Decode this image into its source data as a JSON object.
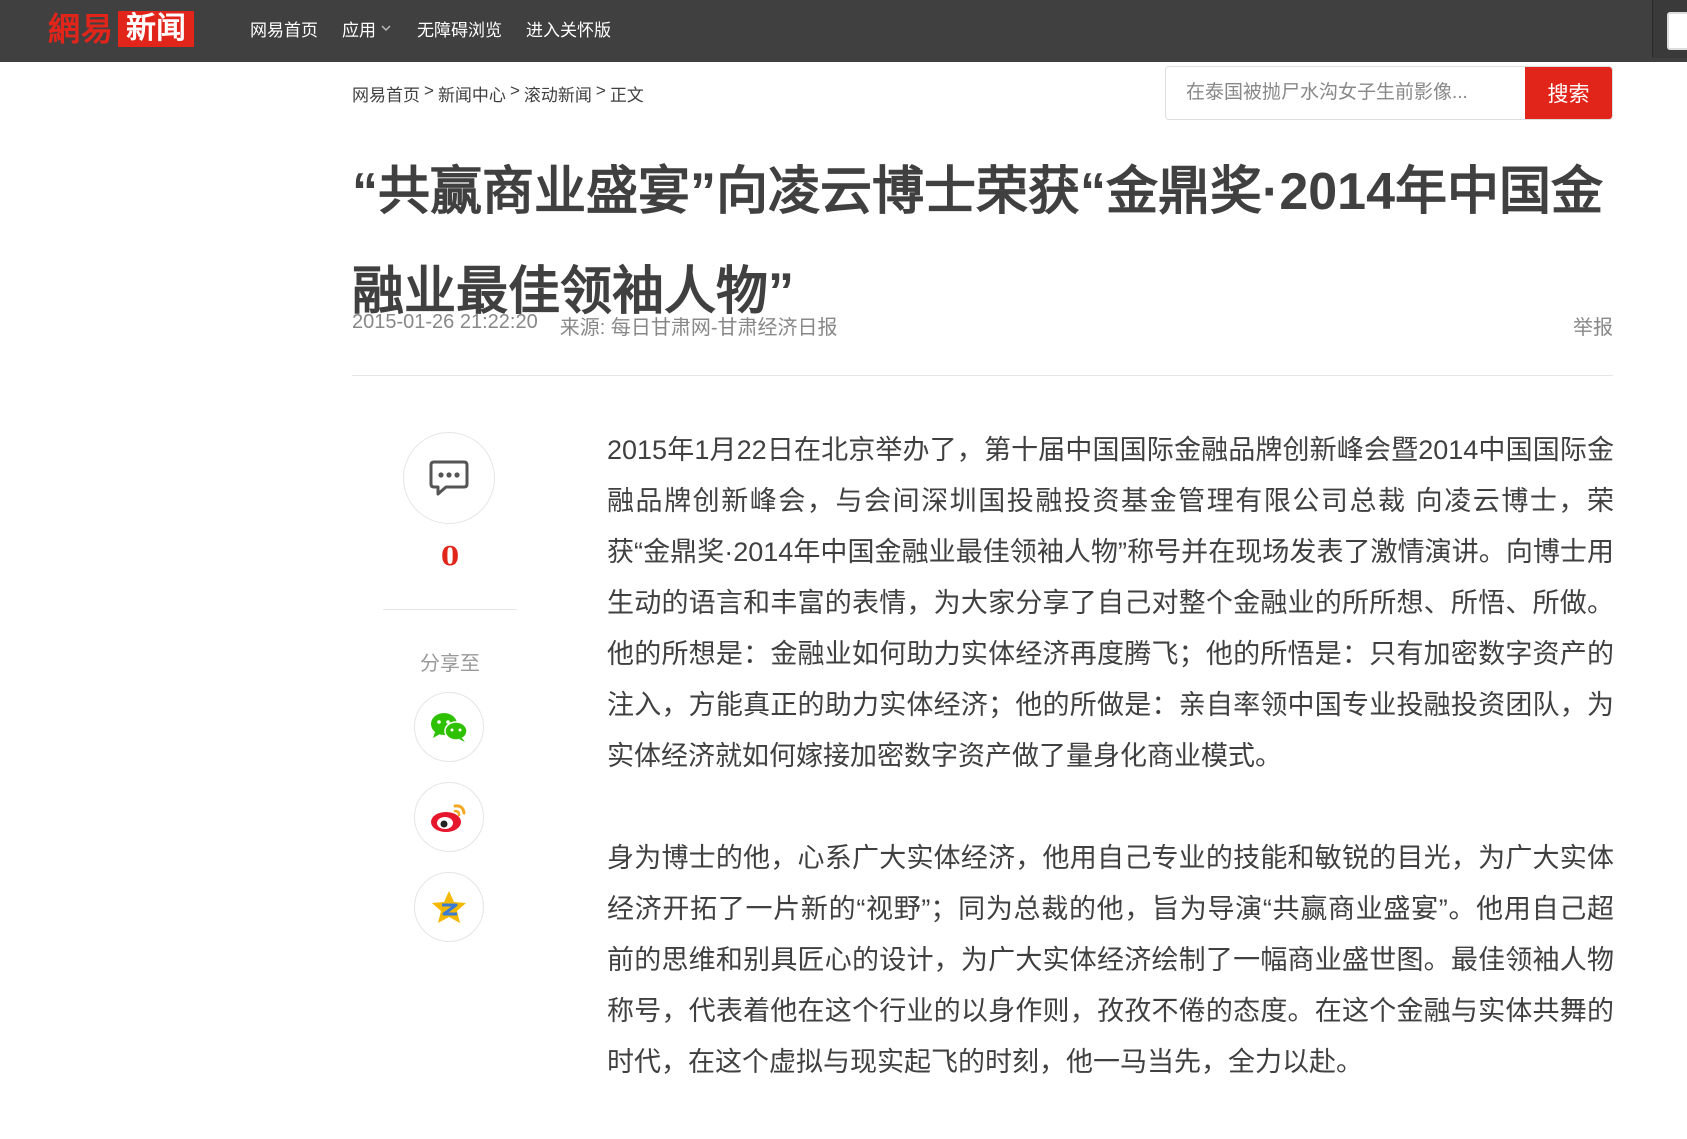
{
  "header": {
    "logo_wangyi": "網易",
    "logo_news": "新闻",
    "nav": [
      {
        "label": "网易首页"
      },
      {
        "label": "应用"
      },
      {
        "label": "无障碍浏览"
      },
      {
        "label": "进入关怀版"
      }
    ]
  },
  "breadcrumb": {
    "items": [
      "网易首页",
      "新闻中心",
      "滚动新闻",
      "正文"
    ],
    "separator": ">"
  },
  "search": {
    "placeholder": "在泰国被抛尸水沟女子生前影像...",
    "button_label": "搜索"
  },
  "article": {
    "title": "“共赢商业盛宴”向凌云博士荣获“金鼎奖·2014年中国金融业最佳领袖人物”",
    "datetime": "2015-01-26 21:22:20",
    "source": "来源: 每日甘肃网-甘肃经济日报",
    "report_label": "举报",
    "paragraphs": [
      "2015年1月22日在北京举办了，第十届中国国际金融品牌创新峰会暨2014中国国际金融品牌创新峰会，与会间深圳国投融投资基金管理有限公司总裁 向凌云博士，荣获“金鼎奖·2014年中国金融业最佳领袖人物”称号并在现场发表了激情演讲。向博士用生动的语言和丰富的表情，为大家分享了自己对整个金融业的所所想、所悟、所做。他的所想是：金融业如何助力实体经济再度腾飞；他的所悟是：只有加密数字资产的注入，方能真正的助力实体经济；他的所做是：亲自率领中国专业投融投资团队，为实体经济就如何嫁接加密数字资产做了量身化商业模式。",
      "身为博士的他，心系广大实体经济，他用自己专业的技能和敏锐的目光，为广大实体经济开拓了一片新的“视野”；同为总裁的他，旨为导演“共赢商业盛宴”。他用自己超前的思维和别具匠心的设计，为广大实体经济绘制了一幅商业盛世图。最佳领袖人物称号，代表着他在这个行业的以身作则，孜孜不倦的态度。在这个金融与实体共舞的时代，在这个虚拟与现实起飞的时刻，他一马当先，全力以赴。"
    ]
  },
  "sidebar": {
    "comment_count": "0",
    "share_label": "分享至",
    "share_targets": [
      "wechat-icon",
      "weibo-icon",
      "qzone-icon"
    ]
  },
  "colors": {
    "topbar": "#404040",
    "brand_red": "#e1251b",
    "text": "#404040",
    "meta": "#888888",
    "wechat_green": "#2dc100",
    "qzone_yellow": "#f5b800"
  }
}
